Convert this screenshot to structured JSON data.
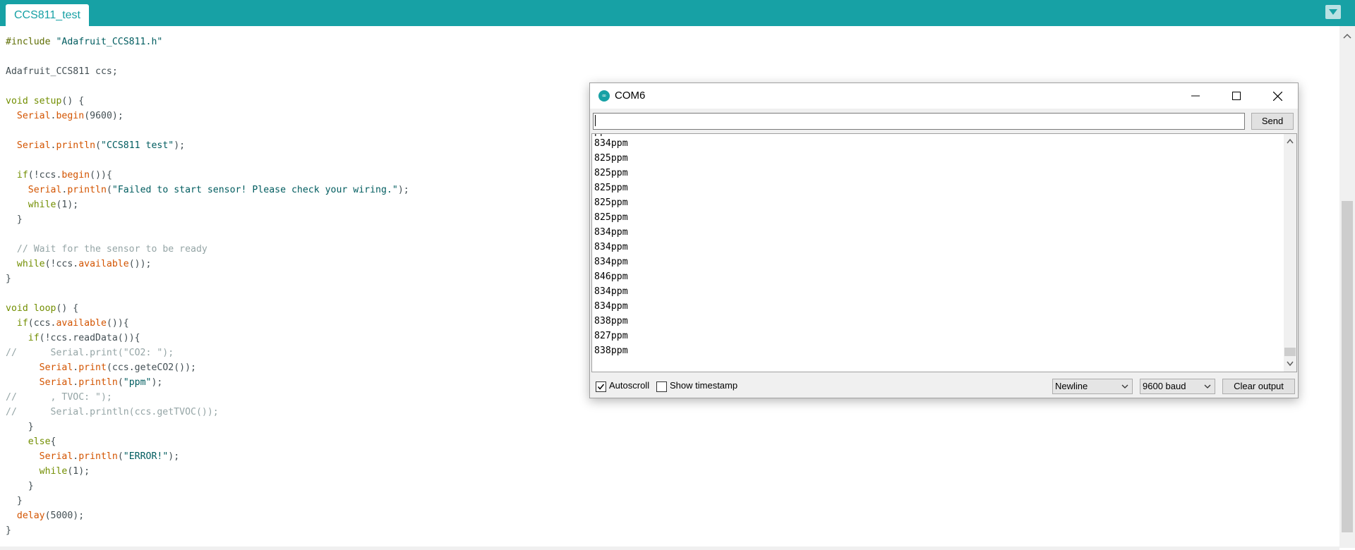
{
  "tabs": [
    {
      "label": "CCS811_test"
    }
  ],
  "editor": {
    "lines": [
      [
        [
          "pp",
          "#include "
        ],
        [
          "str",
          "\"Adafruit_CCS811.h\""
        ]
      ],
      [],
      [
        [
          "txt",
          "Adafruit_CCS811 ccs;"
        ]
      ],
      [],
      [
        [
          "kw",
          "void"
        ],
        [
          "txt",
          " "
        ],
        [
          "kw",
          "setup"
        ],
        [
          "txt",
          "() {"
        ]
      ],
      [
        [
          "txt",
          "  "
        ],
        [
          "fn",
          "Serial"
        ],
        [
          "txt",
          "."
        ],
        [
          "fn",
          "begin"
        ],
        [
          "txt",
          "(9600);"
        ]
      ],
      [],
      [
        [
          "txt",
          "  "
        ],
        [
          "fn",
          "Serial"
        ],
        [
          "txt",
          "."
        ],
        [
          "fn",
          "println"
        ],
        [
          "txt",
          "("
        ],
        [
          "str",
          "\"CCS811 test\""
        ],
        [
          "txt",
          ");"
        ]
      ],
      [],
      [
        [
          "txt",
          "  "
        ],
        [
          "kw",
          "if"
        ],
        [
          "txt",
          "(!ccs."
        ],
        [
          "fn",
          "begin"
        ],
        [
          "txt",
          "()){"
        ]
      ],
      [
        [
          "txt",
          "    "
        ],
        [
          "fn",
          "Serial"
        ],
        [
          "txt",
          "."
        ],
        [
          "fn",
          "println"
        ],
        [
          "txt",
          "("
        ],
        [
          "str",
          "\"Failed to start sensor! Please check your wiring.\""
        ],
        [
          "txt",
          ");"
        ]
      ],
      [
        [
          "txt",
          "    "
        ],
        [
          "kw",
          "while"
        ],
        [
          "txt",
          "(1);"
        ]
      ],
      [
        [
          "txt",
          "  }"
        ]
      ],
      [],
      [
        [
          "txt",
          "  "
        ],
        [
          "cm",
          "// Wait for the sensor to be ready"
        ]
      ],
      [
        [
          "txt",
          "  "
        ],
        [
          "kw",
          "while"
        ],
        [
          "txt",
          "(!ccs."
        ],
        [
          "fn",
          "available"
        ],
        [
          "txt",
          "());"
        ]
      ],
      [
        [
          "txt",
          "}"
        ]
      ],
      [],
      [
        [
          "kw",
          "void"
        ],
        [
          "txt",
          " "
        ],
        [
          "kw",
          "loop"
        ],
        [
          "txt",
          "() {"
        ]
      ],
      [
        [
          "txt",
          "  "
        ],
        [
          "kw",
          "if"
        ],
        [
          "txt",
          "(ccs."
        ],
        [
          "fn",
          "available"
        ],
        [
          "txt",
          "()){"
        ]
      ],
      [
        [
          "txt",
          "    "
        ],
        [
          "kw",
          "if"
        ],
        [
          "txt",
          "(!ccs.readData()){"
        ]
      ],
      [
        [
          "cm",
          "//      Serial.print(\"CO2: \");"
        ]
      ],
      [
        [
          "txt",
          "      "
        ],
        [
          "fn",
          "Serial"
        ],
        [
          "txt",
          "."
        ],
        [
          "fn",
          "print"
        ],
        [
          "txt",
          "(ccs.geteCO2());"
        ]
      ],
      [
        [
          "txt",
          "      "
        ],
        [
          "fn",
          "Serial"
        ],
        [
          "txt",
          "."
        ],
        [
          "fn",
          "println"
        ],
        [
          "txt",
          "("
        ],
        [
          "str",
          "\"ppm\""
        ],
        [
          "txt",
          ");"
        ]
      ],
      [
        [
          "cm",
          "//      , TVOC: \");"
        ]
      ],
      [
        [
          "cm",
          "//      Serial.println(ccs.getTVOC());"
        ]
      ],
      [
        [
          "txt",
          "    }"
        ]
      ],
      [
        [
          "txt",
          "    "
        ],
        [
          "kw",
          "else"
        ],
        [
          "txt",
          "{"
        ]
      ],
      [
        [
          "txt",
          "      "
        ],
        [
          "fn",
          "Serial"
        ],
        [
          "txt",
          "."
        ],
        [
          "fn",
          "println"
        ],
        [
          "txt",
          "("
        ],
        [
          "str",
          "\"ERROR!\""
        ],
        [
          "txt",
          ");"
        ]
      ],
      [
        [
          "txt",
          "      "
        ],
        [
          "kw",
          "while"
        ],
        [
          "txt",
          "(1);"
        ]
      ],
      [
        [
          "txt",
          "    }"
        ]
      ],
      [
        [
          "txt",
          "  }"
        ]
      ],
      [
        [
          "txt",
          "  "
        ],
        [
          "fn",
          "delay"
        ],
        [
          "txt",
          "(5000);"
        ]
      ],
      [
        [
          "txt",
          "}"
        ]
      ]
    ]
  },
  "monitor": {
    "title": "COM6",
    "icon": "arduino-logo-icon",
    "input_value": "",
    "send_label": "Send",
    "output_lines": [
      "834ppm",
      "825ppm",
      "825ppm",
      "825ppm",
      "825ppm",
      "825ppm",
      "834ppm",
      "834ppm",
      "834ppm",
      "846ppm",
      "834ppm",
      "834ppm",
      "838ppm",
      "827ppm",
      "838ppm"
    ],
    "autoscroll_label": "Autoscroll",
    "autoscroll_checked": true,
    "timestamp_label": "Show timestamp",
    "timestamp_checked": false,
    "line_ending": "Newline",
    "baud": "9600 baud",
    "clear_label": "Clear output"
  },
  "colors": {
    "accent": "#17a1a5",
    "keyword": "#728e00",
    "function": "#d35400",
    "string": "#005c5f",
    "comment": "#95a5a6"
  }
}
